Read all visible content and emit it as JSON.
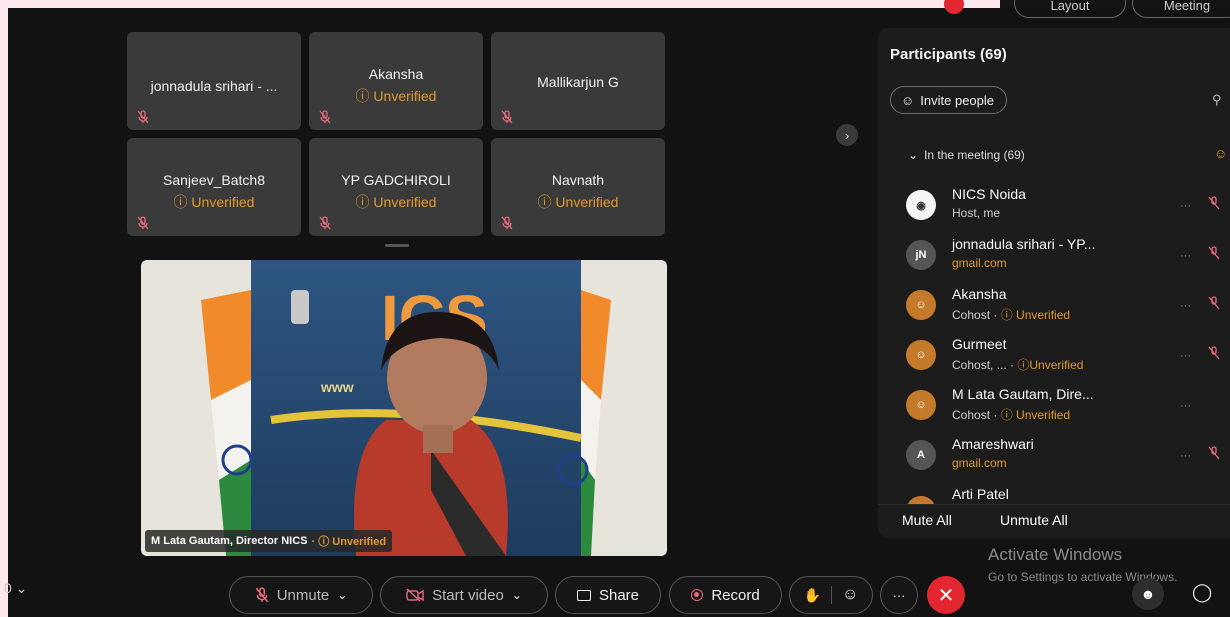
{
  "tiles": [
    {
      "name": "jonnadula srihari - ...",
      "status": ""
    },
    {
      "name": "Akansha",
      "status": "Unverified"
    },
    {
      "name": "Mallikarjun G",
      "status": ""
    },
    {
      "name": "Sanjeev_Batch8",
      "status": "Unverified"
    },
    {
      "name": "YP GADCHIROLI",
      "status": "Unverified"
    },
    {
      "name": "Navnath",
      "status": "Unverified"
    }
  ],
  "video": {
    "speaker": "M Lata Gautam, Director NICS",
    "status": "Unverified",
    "backdrop_text": "ICS",
    "banner_text": "www"
  },
  "top": {
    "layout_label": "Layout",
    "meeting_label": "Meeting"
  },
  "panel": {
    "title": "Participants (69)",
    "invite_label": "Invite people",
    "section_label": "In the meeting (69)",
    "participants": [
      {
        "name": "NICS Noida",
        "sub": "Host, me",
        "tag": "",
        "initials": ""
      },
      {
        "name": "jonnadula srihari - YP...",
        "sub": "gmail.com",
        "tag": "",
        "initials": "jN"
      },
      {
        "name": "Akansha",
        "sub": "Cohost  ·",
        "tag": "Unverified",
        "initials": ""
      },
      {
        "name": "Gurmeet",
        "sub": "Cohost, ...  ·",
        "tag": "Unverified",
        "initials": ""
      },
      {
        "name": "M Lata Gautam, Dire...",
        "sub": "Cohost  ·",
        "tag": "Unverified",
        "initials": ""
      },
      {
        "name": "Amareshwari",
        "sub": "gmail.com",
        "tag": "",
        "initials": "A"
      },
      {
        "name": "Arti Patel",
        "sub": "",
        "tag": "",
        "initials": ""
      }
    ],
    "mute_all": "Mute All",
    "unmute_all": "Unmute All"
  },
  "controls": {
    "unmute": "Unmute",
    "start_video": "Start video",
    "share": "Share",
    "record": "Record",
    "more": "···"
  },
  "watermark": {
    "line1": "Activate Windows",
    "line2": "Go to Settings to activate Windows."
  },
  "colors": {
    "accent_orange": "#e09a2e",
    "end_red": "#e3262f",
    "tile_bg": "#3a3a3a"
  }
}
